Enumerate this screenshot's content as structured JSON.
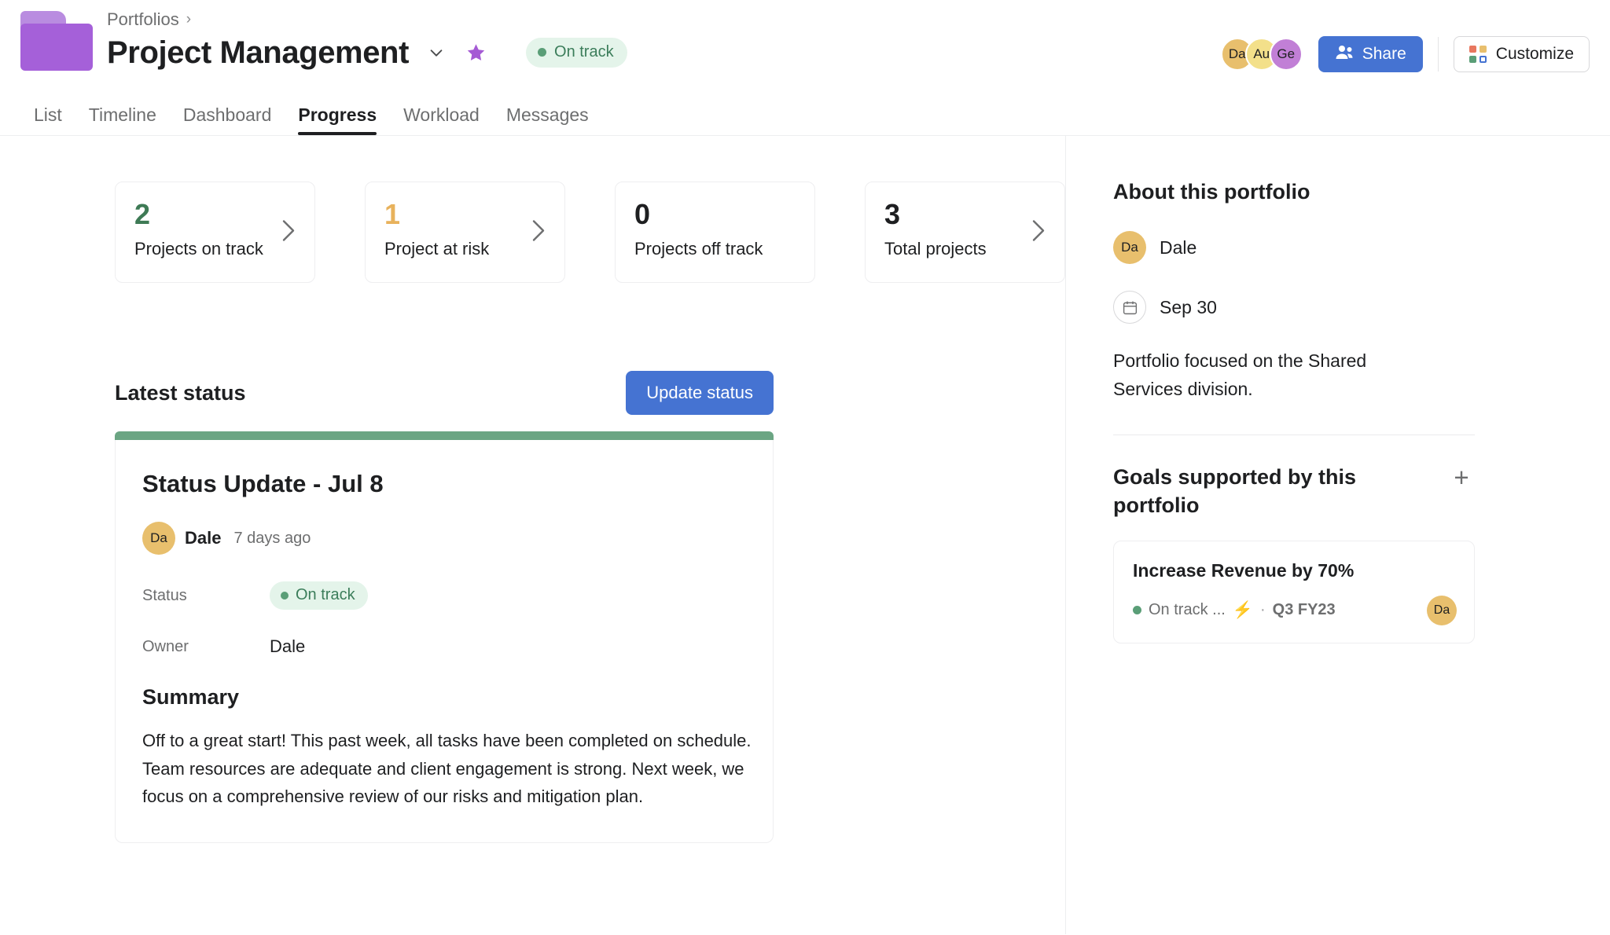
{
  "header": {
    "breadcrumb": "Portfolios",
    "breadcrumb_chevron": "chevron-right-icon",
    "title": "Project Management",
    "status_pill": "On track",
    "avatars": [
      {
        "initials": "Da",
        "color": "#e8bf6d"
      },
      {
        "initials": "Au",
        "color": "#f3e08a"
      },
      {
        "initials": "Ge",
        "color": "#c17fd6"
      }
    ],
    "share_label": "Share",
    "customize_label": "Customize"
  },
  "tabs": [
    {
      "label": "List",
      "active": false
    },
    {
      "label": "Timeline",
      "active": false
    },
    {
      "label": "Dashboard",
      "active": false
    },
    {
      "label": "Progress",
      "active": true
    },
    {
      "label": "Workload",
      "active": false
    },
    {
      "label": "Messages",
      "active": false
    }
  ],
  "stats": [
    {
      "value": "2",
      "label": "Projects on track",
      "color": "#3e7a55",
      "has_chevron": true
    },
    {
      "value": "1",
      "label": "Project at risk",
      "color": "#e8b25c",
      "has_chevron": true
    },
    {
      "value": "0",
      "label": "Projects off track",
      "color": "#1e1f21",
      "has_chevron": false
    },
    {
      "value": "3",
      "label": "Total projects",
      "color": "#1e1f21",
      "has_chevron": true
    }
  ],
  "latest_status": {
    "heading": "Latest status",
    "update_button": "Update status",
    "accent_color": "#6ba583",
    "card": {
      "title": "Status Update - Jul 8",
      "author_initials": "Da",
      "author_name": "Dale",
      "timestamp": "7 days ago",
      "status_label": "Status",
      "status_value": "On track",
      "owner_label": "Owner",
      "owner_value": "Dale",
      "summary_heading": "Summary",
      "summary_body": "Off to a great start! This past week, all tasks have been completed on schedule. Team resources are adequate and client engagement is strong. Next week, we focus on a comprehensive review of our risks and mitigation plan."
    }
  },
  "about": {
    "heading": "About this portfolio",
    "owner_initials": "Da",
    "owner_name": "Dale",
    "due_date": "Sep 30",
    "description": "Portfolio focused on the Shared Services division."
  },
  "goals": {
    "heading": "Goals supported by this portfolio",
    "add_label": "+",
    "items": [
      {
        "name": "Increase Revenue by 70%",
        "status": "On track ...",
        "separator": "·",
        "quarter": "Q3 FY23",
        "avatar_initials": "Da"
      }
    ]
  }
}
